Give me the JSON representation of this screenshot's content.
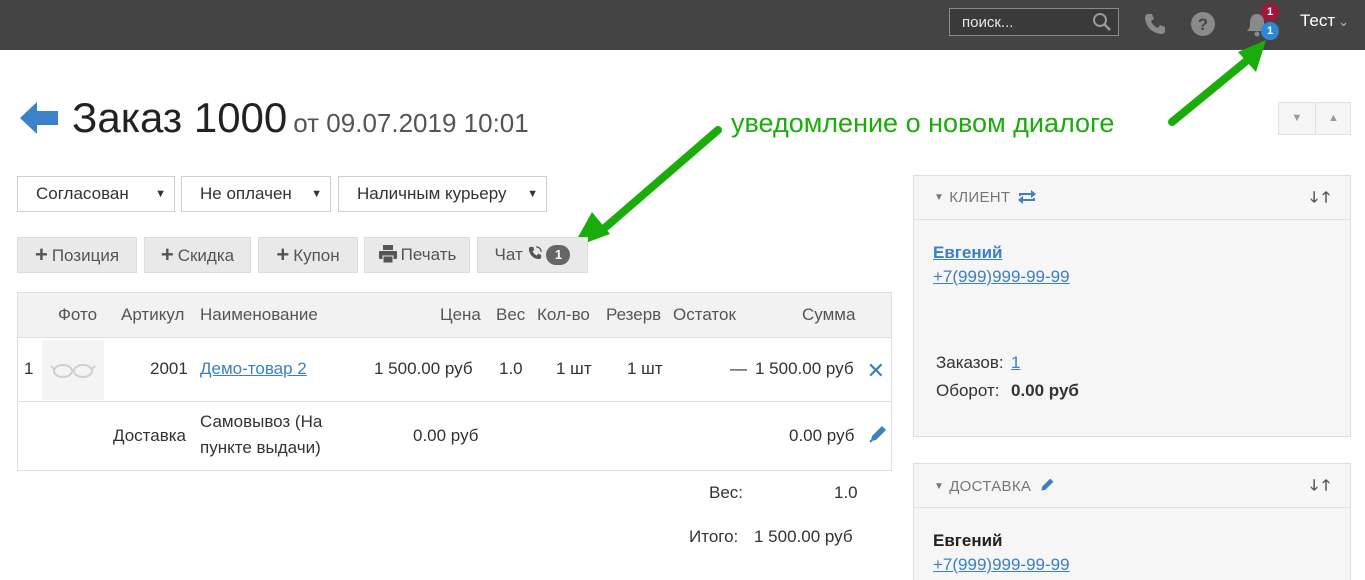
{
  "topbar": {
    "search_placeholder": "поиск...",
    "notif_badge_red": "1",
    "notif_badge_blue": "1",
    "user_name": "Тест"
  },
  "header": {
    "title": "Заказ 1000",
    "date": "от 09.07.2019 10:01"
  },
  "annotation": "уведомление о новом диалоге",
  "filters": {
    "status": "Согласован",
    "payment": "Не оплачен",
    "delivery": "Наличным курьеру"
  },
  "actions": {
    "position": "Позиция",
    "discount": "Скидка",
    "coupon": "Купон",
    "print": "Печать",
    "chat": "Чат",
    "chat_count": "1"
  },
  "table": {
    "headers": {
      "photo": "Фото",
      "sku": "Артикул",
      "name": "Наименование",
      "price": "Цена",
      "weight": "Вес",
      "qty": "Кол-во",
      "reserve": "Резерв",
      "stock": "Остаток",
      "sum": "Сумма"
    },
    "item": {
      "num": "1",
      "sku": "2001",
      "name": "Демо-товар 2",
      "price": "1 500.00 руб",
      "weight": "1.0",
      "qty": "1 шт",
      "reserve": "1 шт",
      "stock": "—",
      "sum": "1 500.00 руб"
    },
    "delivery": {
      "label": "Доставка",
      "name_line1": "Самовывоз (На",
      "name_line2": "пункте выдачи)",
      "price": "0.00 руб",
      "sum": "0.00 руб"
    }
  },
  "totals": {
    "weight_label": "Вес:",
    "weight_value": "1.0",
    "total_label": "Итого:",
    "total_value": "1 500.00 руб"
  },
  "client_panel": {
    "title": "КЛИЕНТ",
    "name": "Евгений",
    "phone": "+7(999)999-99-99",
    "orders_label": "Заказов:",
    "orders_value": "1",
    "turnover_label": "Оборот:",
    "turnover_value": "0.00 руб"
  },
  "delivery_panel": {
    "title": "ДОСТАВКА",
    "name": "Евгений",
    "phone": "+7(999)999-99-99"
  },
  "colors": {
    "topbar": "#444444",
    "link": "#3b7fc4",
    "annotation": "#1aac0a",
    "badge_red": "#a3183a",
    "badge_blue": "#2f88d6"
  }
}
